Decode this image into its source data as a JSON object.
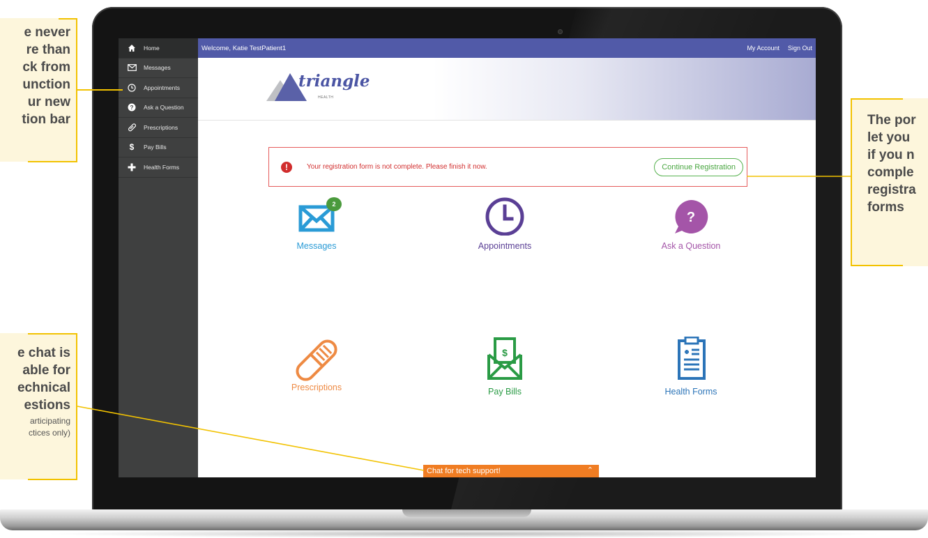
{
  "sidebar": {
    "items": [
      {
        "label": "Home",
        "icon": "home-icon"
      },
      {
        "label": "Messages",
        "icon": "envelope-icon"
      },
      {
        "label": "Appointments",
        "icon": "clock-icon"
      },
      {
        "label": "Ask a Question",
        "icon": "question-icon"
      },
      {
        "label": "Prescriptions",
        "icon": "pill-icon"
      },
      {
        "label": "Pay Bills",
        "icon": "dollar-icon"
      },
      {
        "label": "Health Forms",
        "icon": "plus-icon"
      }
    ]
  },
  "header": {
    "welcome": "Welcome, Katie TestPatient1",
    "my_account": "My Account",
    "sign_out": "Sign Out"
  },
  "brand": {
    "logo_text": "triangle",
    "logo_sub": "HEALTH"
  },
  "alert": {
    "message": "Your registration form is not complete. Please finish it now.",
    "button": "Continue Registration"
  },
  "tiles": {
    "messages": {
      "label": "Messages",
      "badge": "2",
      "color": "#2a9bd6"
    },
    "appointments": {
      "label": "Appointments",
      "color": "#5a3f95"
    },
    "ask": {
      "label": "Ask a Question",
      "color": "#a455a8"
    },
    "prescriptions": {
      "label": "Prescriptions",
      "color": "#ee8a43"
    },
    "pay_bills": {
      "label": "Pay Bills",
      "color": "#2a9b45"
    },
    "health_forms": {
      "label": "Health Forms",
      "color": "#2b74b8"
    }
  },
  "chat": {
    "label": "Chat for tech support!"
  },
  "callouts": {
    "left_top": [
      "e never",
      "re than",
      "ck from",
      "unction",
      "ur new",
      "tion bar"
    ],
    "left_bottom": [
      "e chat is",
      "able for",
      "echnical",
      "estions"
    ],
    "left_bottom_sub": [
      "articipating",
      "ctices only)"
    ],
    "right": [
      "The por",
      "let you",
      "if you n",
      "comple",
      "registra",
      "forms"
    ]
  },
  "colors": {
    "topbar": "#515aa8",
    "sidebar": "#3f4040",
    "accent_orange": "#f07d23",
    "callout_line": "#f2c200"
  }
}
